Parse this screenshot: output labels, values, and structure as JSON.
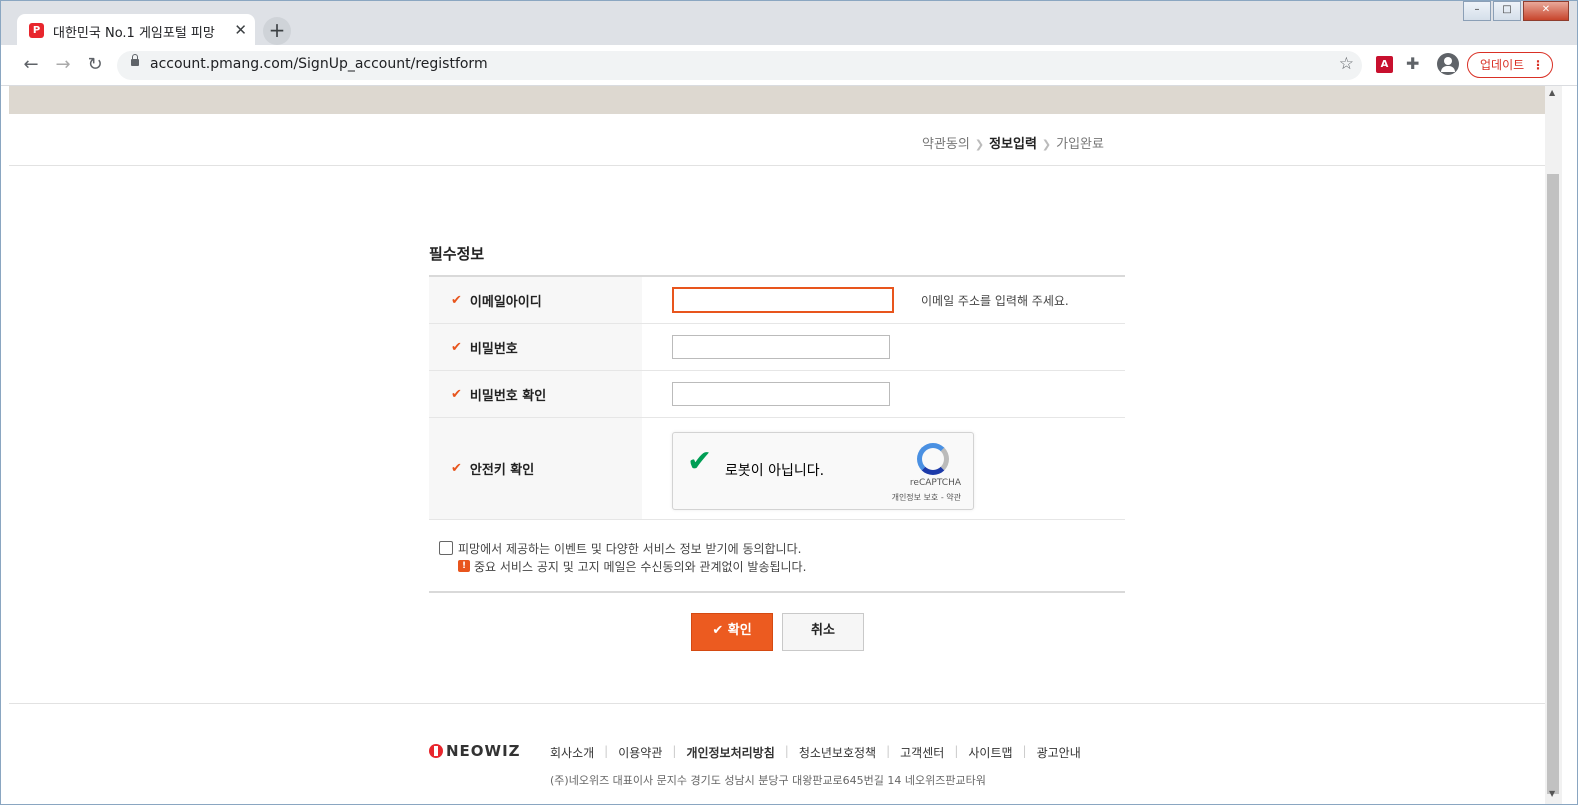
{
  "browser": {
    "tab_title": "대한민국 No.1 게임포털 피망",
    "tab_favicon": "P",
    "tab_close": "✕",
    "newtab": "+",
    "url": "account.pmang.com/SignUp_account/registform",
    "update_label": "업데이트",
    "update_dots": "⋮",
    "back": "←",
    "forward": "→",
    "reload": "↻",
    "star": "☆",
    "pdf_icon": "A",
    "puzzle_icon": "✚",
    "win_min": "–",
    "win_max": "□",
    "win_close": "✕"
  },
  "steps": {
    "step1": "약관동의",
    "step2": "정보입력",
    "step3": "가입완료",
    "arrow": "❯"
  },
  "form": {
    "section_title": "필수정보",
    "check": "✔",
    "email_label": "이메일아이디",
    "email_hint": "이메일 주소를 입력해 주세요.",
    "email_value": "",
    "password_label": "비밀번호",
    "password_confirm_label": "비밀번호 확인",
    "captcha_label": "안전키 확인"
  },
  "captcha": {
    "checkmark": "✔",
    "text": "로봇이 아닙니다.",
    "brand": "reCAPTCHA",
    "privacy": "개인정보 보호",
    "sep": " - ",
    "terms": "약관"
  },
  "agree": {
    "text": "피망에서 제공하는 이벤트 및 다양한 서비스 정보 받기에 동의합니다.",
    "warn_icon": "!",
    "notice": "중요 서비스 공지 및 고지 메일은 수신동의와 관계없이 발송됩니다."
  },
  "buttons": {
    "confirm": "확인",
    "confirm_icon": "✔",
    "cancel": "취소"
  },
  "footer": {
    "logo": "NEOWIZ",
    "links": [
      "회사소개",
      "이용약관",
      "개인정보처리방침",
      "청소년보호정책",
      "고객센터",
      "사이트맵",
      "광고안내"
    ],
    "address": "(주)네오위즈 대표이사 문지수 경기도 성남시 분당구 대왕판교로645번길 14 네오위즈판교타워"
  },
  "scrollbar": {
    "up": "▲",
    "down": "▼"
  }
}
